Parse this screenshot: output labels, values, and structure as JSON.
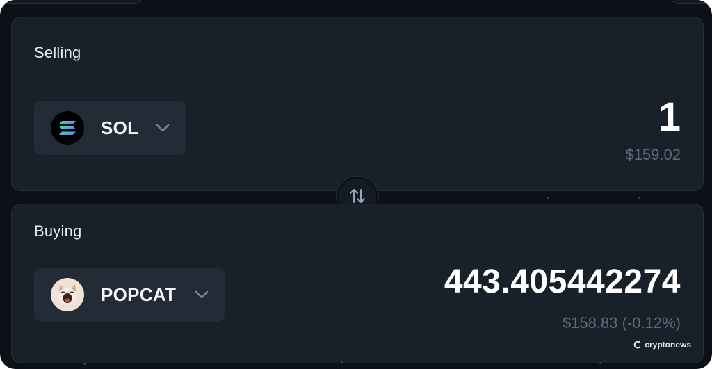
{
  "selling": {
    "label": "Selling",
    "token": {
      "symbol": "SOL",
      "icon": "solana-logo-icon"
    },
    "amount": "1",
    "usd_value": "$159.02"
  },
  "buying": {
    "label": "Buying",
    "token": {
      "symbol": "POPCAT",
      "icon": "popcat-logo-icon"
    },
    "amount": "443.405442274",
    "usd_value": "$158.83 (-0.12%)"
  },
  "swap_button": {
    "icon": "swap-arrows-icon"
  },
  "watermark": {
    "text": "cryptonews"
  },
  "colors": {
    "background": "#0d1117",
    "panel": "#182029",
    "token_button": "#222b36",
    "muted_text": "#5f6b7a",
    "solana_gradient": [
      "#9945ff",
      "#14f195"
    ]
  }
}
